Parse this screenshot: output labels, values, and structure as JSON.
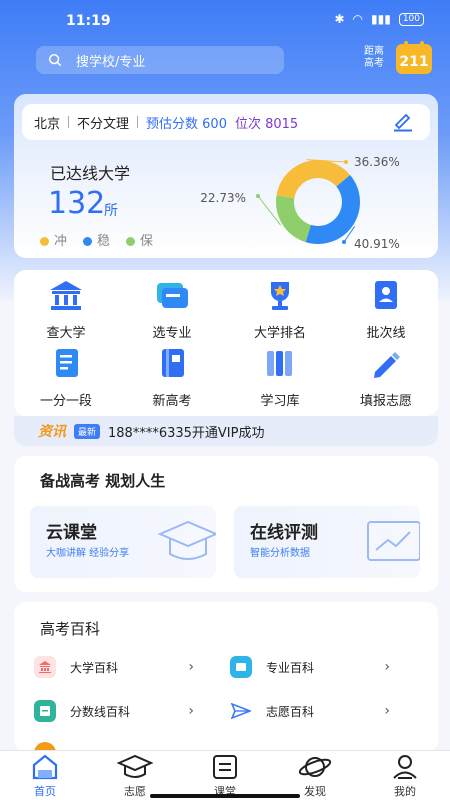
{
  "status": {
    "time": "11:19",
    "battery": "100"
  },
  "search": {
    "placeholder": "搜学校/专业"
  },
  "exam": {
    "label_line1": "距离",
    "label_line2": "高考",
    "days": "211"
  },
  "profile": {
    "region": "北京",
    "track": "不分文理",
    "score_text": "预估分数 600",
    "rank_text": "位次 8015"
  },
  "reach": {
    "title": "已达线大学",
    "count": "132",
    "unit": "所",
    "legend": [
      {
        "label": "冲",
        "color": "#f7bd3a"
      },
      {
        "label": "稳",
        "color": "#2f8af5"
      },
      {
        "label": "保",
        "color": "#8fcf6b"
      }
    ]
  },
  "chart_data": {
    "type": "pie",
    "slices": [
      {
        "label": "冲",
        "value": 36.36,
        "color": "#f7bd3a",
        "text": "36.36%"
      },
      {
        "label": "稳",
        "value": 40.91,
        "color": "#2f8af5",
        "text": "40.91%"
      },
      {
        "label": "保",
        "value": 22.73,
        "color": "#8fcf6b",
        "text": "22.73%"
      }
    ]
  },
  "grid": [
    {
      "label": "查大学",
      "icon": "university-icon"
    },
    {
      "label": "选专业",
      "icon": "major-icon"
    },
    {
      "label": "大学排名",
      "icon": "trophy-icon"
    },
    {
      "label": "批次线",
      "icon": "batch-line-icon"
    },
    {
      "label": "一分一段",
      "icon": "score-doc-icon"
    },
    {
      "label": "新高考",
      "icon": "new-exam-icon"
    },
    {
      "label": "学习库",
      "icon": "library-icon"
    },
    {
      "label": "填报志愿",
      "icon": "pencil-icon"
    }
  ],
  "news": {
    "tag": "资讯",
    "badge": "最新",
    "text": "188****6335开通VIP成功"
  },
  "prep": {
    "title": "备战高考 规划人生",
    "features": [
      {
        "title": "云课堂",
        "subtitle": "大咖讲解 经验分享"
      },
      {
        "title": "在线评测",
        "subtitle": "智能分析数据"
      }
    ]
  },
  "wiki": {
    "title": "高考百科",
    "items": [
      {
        "label": "大学百科",
        "color": "#f26a6a"
      },
      {
        "label": "专业百科",
        "color": "#2fb4e8"
      },
      {
        "label": "分数线百科",
        "color": "#2fb49a"
      },
      {
        "label": "志愿百科",
        "color": "#3f7df7"
      }
    ]
  },
  "tabs": [
    {
      "label": "首页",
      "active": true
    },
    {
      "label": "志愿"
    },
    {
      "label": "课堂"
    },
    {
      "label": "发现"
    },
    {
      "label": "我的"
    }
  ]
}
